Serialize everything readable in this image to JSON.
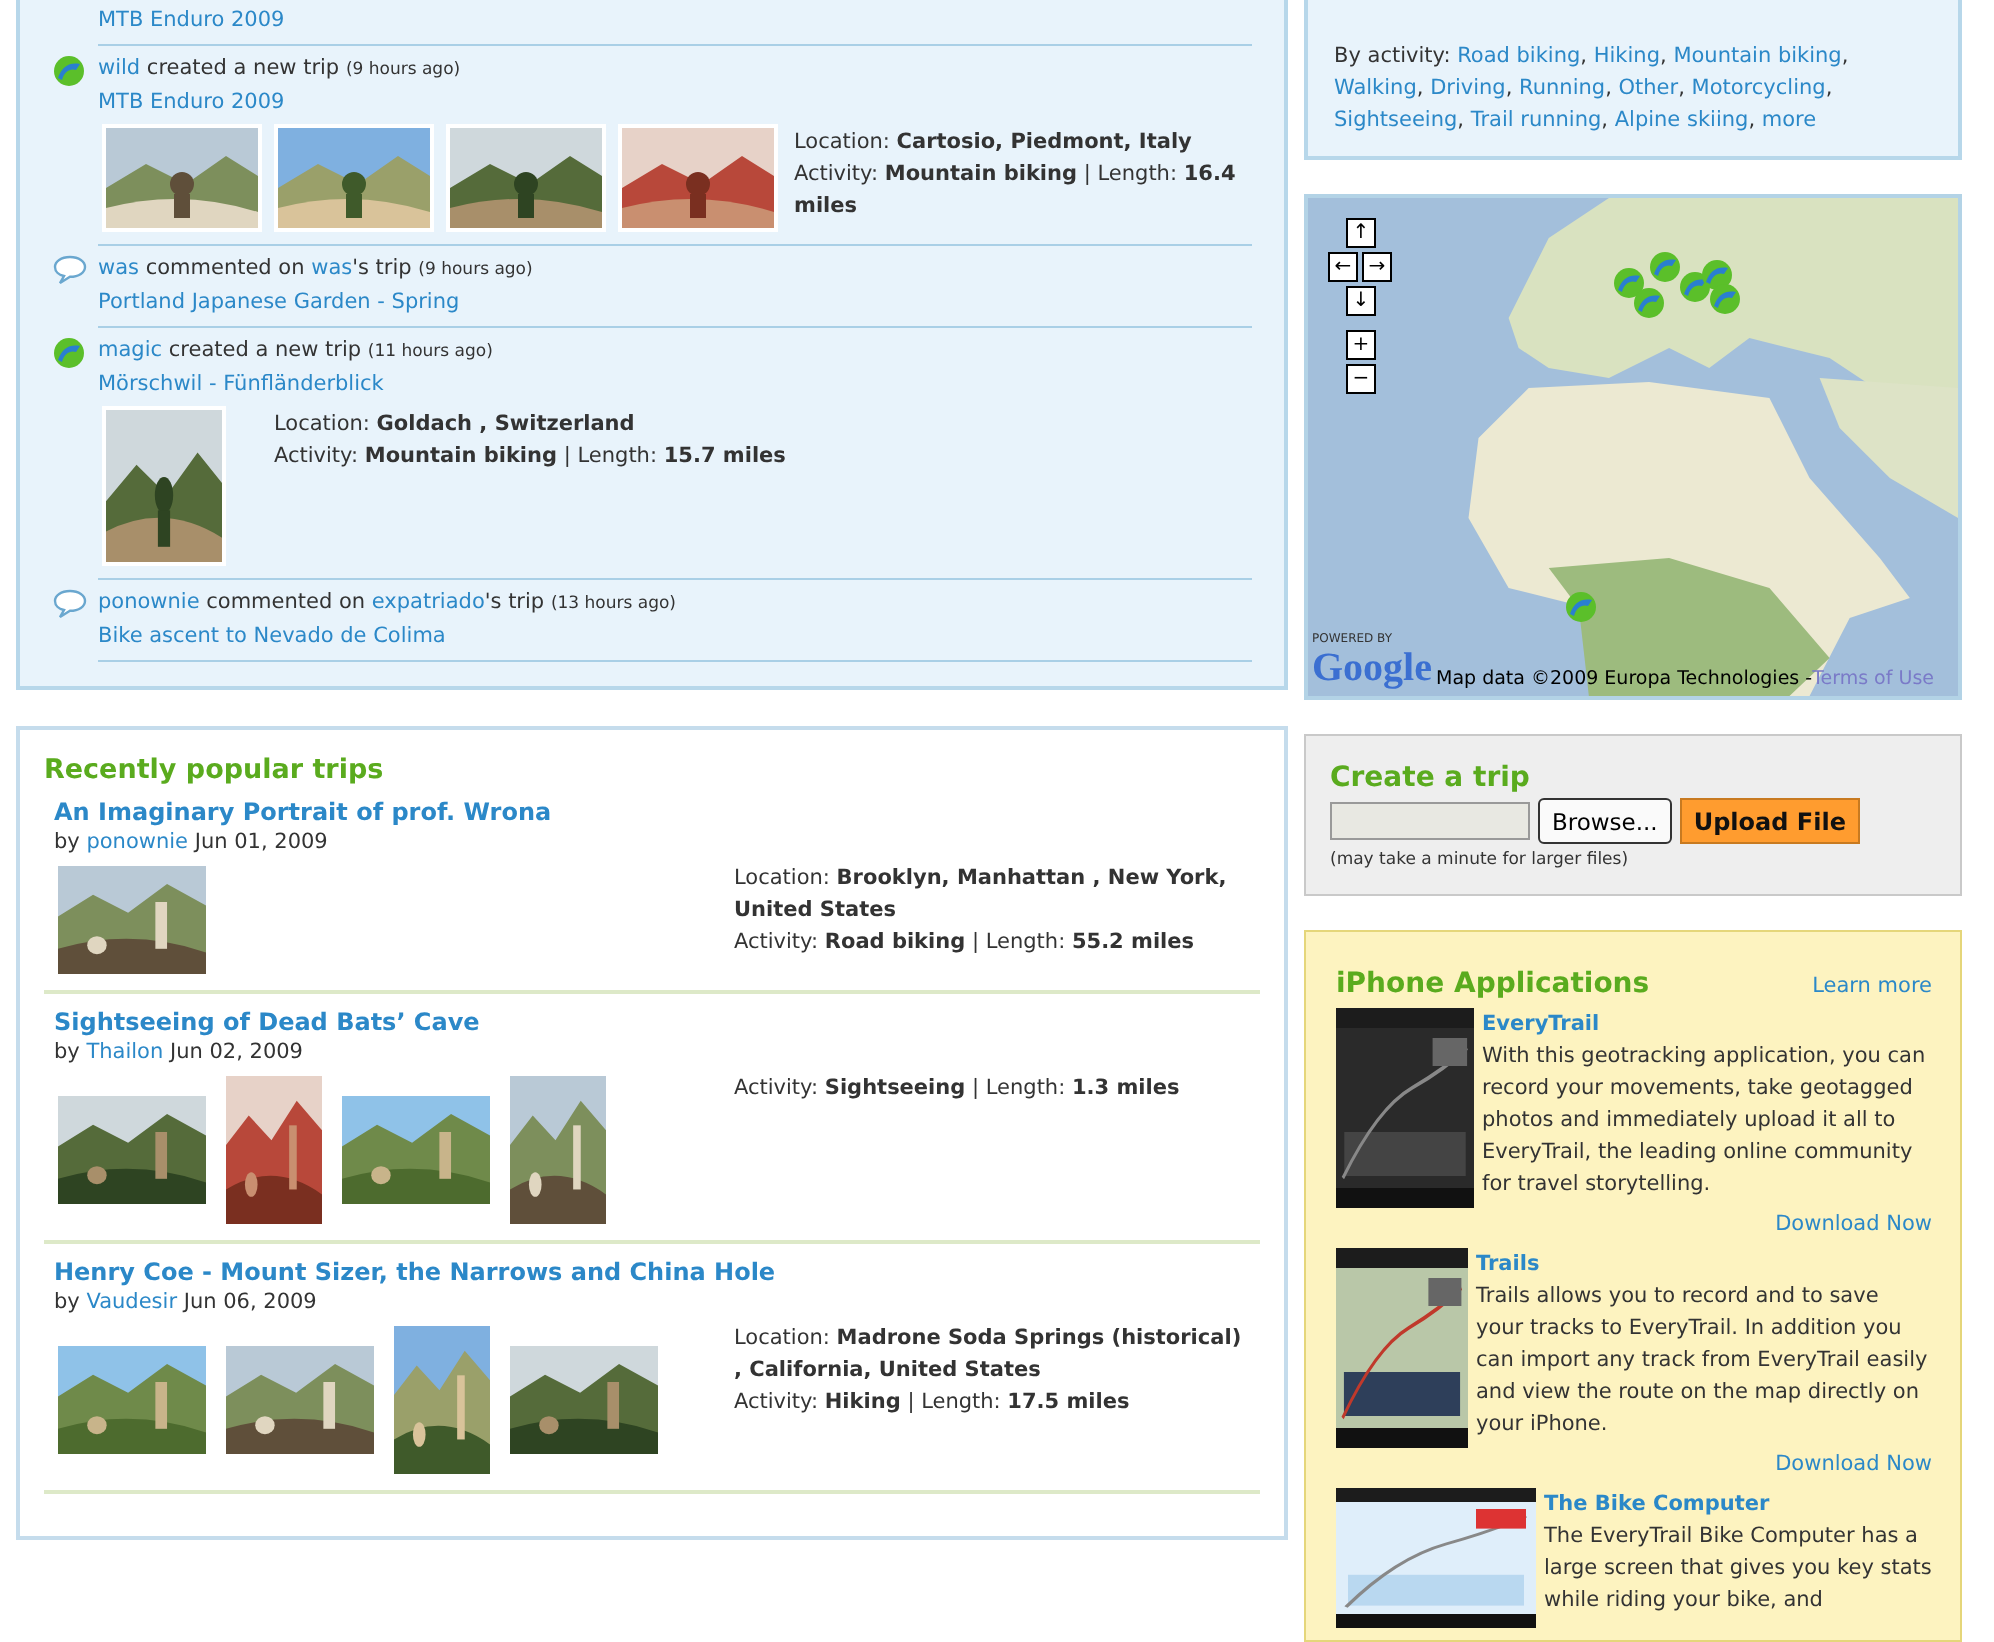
{
  "feed": {
    "items": [
      {
        "kind": "partial",
        "trip": "MTB Enduro 2009"
      },
      {
        "kind": "created",
        "user": "wild",
        "action": "created a new trip",
        "time": "(9 hours ago)",
        "trip": "MTB Enduro 2009",
        "location": "Location: **Cartosio, Piedmont, Italy**",
        "activity": "Activity: **Mountain biking** | Length: **16.4 miles**"
      },
      {
        "kind": "commented",
        "user": "was",
        "action": "commented on",
        "owner": "was",
        "owner_suffix": "'s trip",
        "time": "(9 hours ago)",
        "trip": "Portland Japanese Garden - Spring"
      },
      {
        "kind": "created",
        "user": "magic",
        "action": "created a new trip",
        "time": "(11 hours ago)",
        "trip": "Mörschwil - Fünfländerblick",
        "location": "Location: **Goldach , Switzerland**",
        "activity": "Activity: **Mountain biking** | Length: **15.7 miles**"
      },
      {
        "kind": "commented",
        "user": "ponownie",
        "action": "commented on",
        "owner": "expatriado",
        "owner_suffix": "'s trip",
        "time": "(13 hours ago)",
        "trip": "Bike ascent to Nevado de Colima"
      }
    ]
  },
  "popular": {
    "title": "Recently popular trips",
    "trips": [
      {
        "title": "An Imaginary Portrait of prof. Wrona",
        "by": "by",
        "user": "ponownie",
        "date": "Jun 01, 2009",
        "location": "Location: **Brooklyn, Manhattan , New York, United States**",
        "activity": "Activity: **Road biking**  |  Length: **55.2 miles**"
      },
      {
        "title": "Sightseeing of Dead Bats’ Cave",
        "by": "by",
        "user": "Thailon",
        "date": "Jun 02, 2009",
        "activity": "Activity: **Sightseeing**  |  Length: **1.3 miles**"
      },
      {
        "title": "Henry Coe - Mount Sizer, the Narrows and China Hole",
        "by": "by",
        "user": "Vaudesir",
        "date": "Jun 06, 2009",
        "location": "Location: **Madrone Soda Springs (historical) , California, United States**",
        "activity": "Activity: **Hiking**  |  Length: **17.5 miles**"
      }
    ]
  },
  "activities": {
    "label": "By activity:",
    "separator": ",",
    "links": [
      "Road biking",
      "Hiking",
      "Mountain biking",
      "Walking",
      "Driving",
      "Running",
      "Other",
      "Motorcycling",
      "Sightseeing",
      "Trail running",
      "Alpine skiing",
      "more"
    ]
  },
  "map": {
    "controls": [
      "↑",
      "←",
      "→",
      "↓",
      "+",
      "−"
    ],
    "powered_by": "POWERED BY",
    "logo": "Google",
    "credit": "Map data ©2009 Europa Technologies -",
    "terms": "Terms of Use"
  },
  "create_trip": {
    "title": "Create a trip",
    "browse": "Browse...",
    "upload": "Upload File",
    "note": "(may take a minute for larger files)"
  },
  "iphone": {
    "title": "iPhone Applications",
    "learn_more": "Learn more",
    "apps": [
      {
        "name": "EveryTrail",
        "description": "With this geotracking application, you can record your movements, take geotagged photos and immediately upload it all to EveryTrail, the leading online community for travel storytelling.",
        "download": "Download Now"
      },
      {
        "name": "Trails",
        "description": "Trails allows you to record and to save your tracks to EveryTrail. In addition you can import any track from EveryTrail easily and view the route on the map directly on your iPhone.",
        "download": "Download Now"
      },
      {
        "name": "The Bike Computer",
        "description": "The EveryTrail Bike Computer has a large screen that gives you key stats while riding your bike, and"
      }
    ]
  }
}
